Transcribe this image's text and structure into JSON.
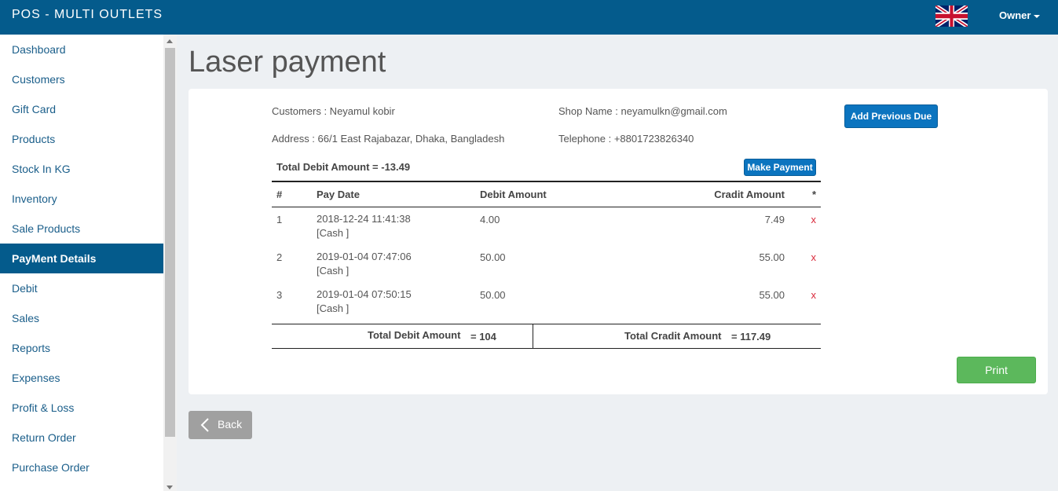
{
  "app": {
    "brand": "POS - MULTI OUTLETS",
    "user_menu": "Owner"
  },
  "sidebar": {
    "items": [
      {
        "label": "Dashboard"
      },
      {
        "label": "Customers"
      },
      {
        "label": "Gift Card"
      },
      {
        "label": "Products"
      },
      {
        "label": "Stock In KG"
      },
      {
        "label": "Inventory"
      },
      {
        "label": "Sale Products"
      },
      {
        "label": "PayMent Details",
        "active": true
      },
      {
        "label": "Debit"
      },
      {
        "label": "Sales"
      },
      {
        "label": "Reports"
      },
      {
        "label": "Expenses"
      },
      {
        "label": "Profit & Loss"
      },
      {
        "label": "Return Order"
      },
      {
        "label": "Purchase Order"
      }
    ]
  },
  "page": {
    "title": "Laser payment"
  },
  "info": {
    "customer": "Customers : Neyamul kobir",
    "address": "Address : 66/1 East Rajabazar, Dhaka, Bangladesh",
    "shop": "Shop Name : neyamulkn@gmail.com",
    "telephone": "Telephone : +8801723826340"
  },
  "buttons": {
    "add_previous_due": "Add Previous Due",
    "make_payment": "Make Payment",
    "print": "Print",
    "back": "Back"
  },
  "summary": {
    "total_debit_header": "Total Debit Amount = -13.49"
  },
  "table": {
    "headers": {
      "num": "#",
      "pay_date": "Pay Date",
      "debit": "Debit Amount",
      "credit": "Cradit Amount",
      "star": "*"
    },
    "rows": [
      {
        "num": "1",
        "date": "2018-12-24 11:41:38",
        "method": "[Cash ]",
        "debit": "4.00",
        "credit": "7.49",
        "delete": "x"
      },
      {
        "num": "2",
        "date": "2019-01-04 07:47:06",
        "method": "[Cash ]",
        "debit": "50.00",
        "credit": "55.00",
        "delete": "x"
      },
      {
        "num": "3",
        "date": "2019-01-04 07:50:15",
        "method": "[Cash ]",
        "debit": "50.00",
        "credit": "55.00",
        "delete": "x"
      }
    ],
    "totals": {
      "debit_label": "Total Debit Amount",
      "debit_value": "= 104",
      "credit_label": "Total Cradit Amount",
      "credit_value": "= 117.49"
    }
  },
  "icons": {
    "flag": "uk-flag-icon",
    "caret": "caret-down-icon",
    "back": "chevron-left-icon"
  },
  "colors": {
    "header": "#045b8c",
    "primary": "#0b74bf",
    "success": "#5cb85c",
    "danger": "#d9283a"
  }
}
